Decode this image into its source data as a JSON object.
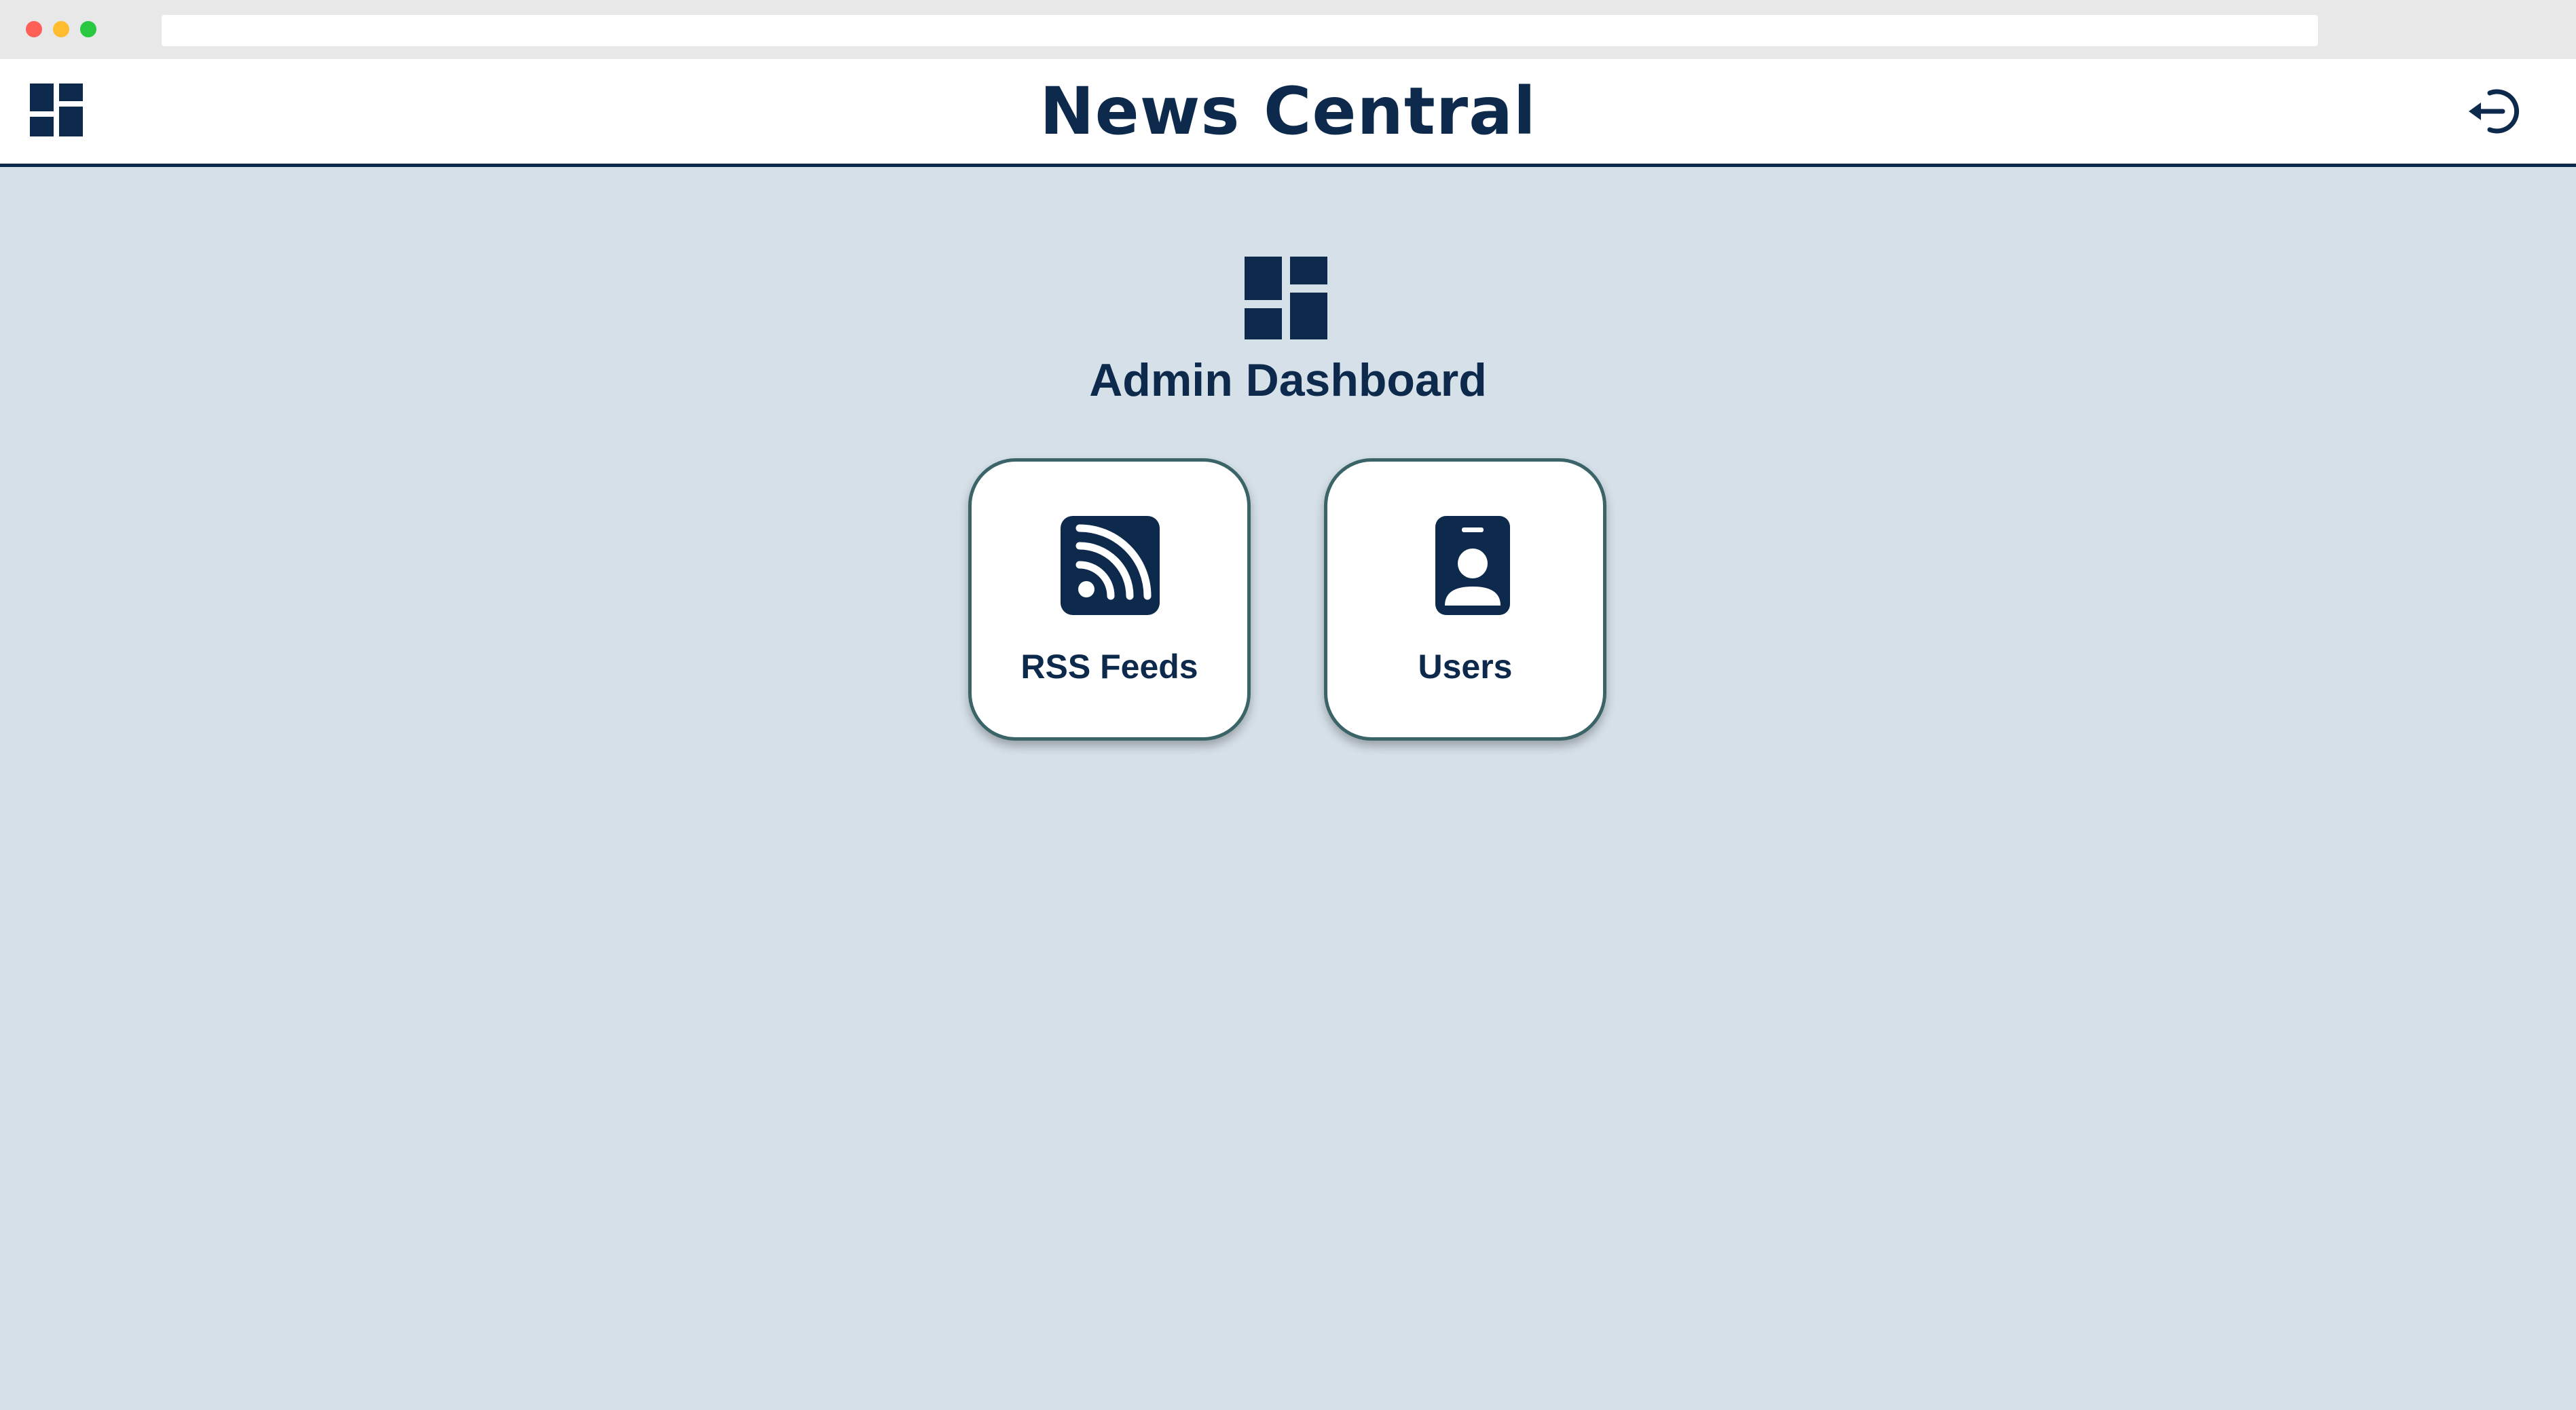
{
  "app": {
    "title": "News Central"
  },
  "header": {
    "dashboard_icon": "dashboard-icon",
    "logout_icon": "logout-icon"
  },
  "main": {
    "hero_icon": "dashboard-icon",
    "heading": "Admin Dashboard",
    "cards": [
      {
        "label": "RSS Feeds",
        "icon": "rss-feed-icon"
      },
      {
        "label": "Users",
        "icon": "user-badge-icon"
      }
    ]
  },
  "colors": {
    "primary": "#0d2a4c",
    "background": "#d6e0e9",
    "card_border": "#3a6468",
    "header_background": "#ffffff"
  }
}
